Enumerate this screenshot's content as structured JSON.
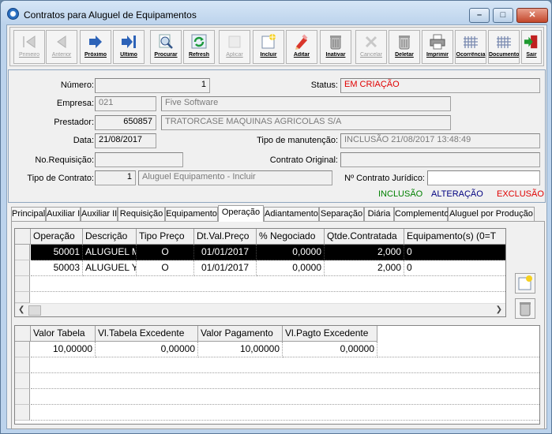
{
  "window": {
    "title": "Contratos para Aluguel de Equipamentos",
    "controls": [
      "minimize",
      "maximize",
      "close"
    ]
  },
  "toolbar": {
    "buttons": [
      {
        "label": "Primeiro",
        "icon": "first-icon",
        "enabled": false
      },
      {
        "label": "Anterior",
        "icon": "previous-icon",
        "enabled": false
      },
      {
        "label": "Próximo",
        "icon": "next-icon",
        "enabled": true
      },
      {
        "label": "Último",
        "icon": "last-icon",
        "enabled": true
      },
      {
        "label": "Procurar",
        "icon": "search-icon",
        "enabled": true
      },
      {
        "label": "Refresh",
        "icon": "refresh-icon",
        "enabled": true
      },
      {
        "label": "Aplicar",
        "icon": "apply-icon",
        "enabled": false
      },
      {
        "label": "Incluir",
        "icon": "new-icon",
        "enabled": true
      },
      {
        "label": "Aditar",
        "icon": "edit-icon",
        "enabled": true
      },
      {
        "label": "Inativar",
        "icon": "deactivate-icon",
        "enabled": true
      },
      {
        "label": "Cancelar",
        "icon": "cancel-icon",
        "enabled": false
      },
      {
        "label": "Deletar",
        "icon": "delete-icon",
        "enabled": true
      },
      {
        "label": "Imprimir",
        "icon": "print-icon",
        "enabled": true
      },
      {
        "label": "Ocorrência",
        "icon": "occurrence-icon",
        "enabled": true
      },
      {
        "label": "Documento",
        "icon": "document-icon",
        "enabled": true
      },
      {
        "label": "Sair",
        "icon": "exit-icon",
        "enabled": true
      }
    ]
  },
  "form": {
    "numero_label": "Número:",
    "numero": "1",
    "status_label": "Status:",
    "status": "EM CRIAÇÃO",
    "empresa_label": "Empresa:",
    "empresa_code": "021",
    "empresa_name": "Five Software",
    "prestador_label": "Prestador:",
    "prestador_code": "650857",
    "prestador_name": "TRATORCASE MAQUINAS AGRICOLAS S/A",
    "data_label": "Data:",
    "data": "21/08/2017",
    "tipo_manutencao_label": "Tipo de manutenção:",
    "tipo_manutencao": "INCLUSÃO 21/08/2017 13:48:49",
    "no_requisicao_label": "No.Requisição:",
    "no_requisicao": "",
    "contrato_original_label": "Contrato Original:",
    "contrato_original": "",
    "tipo_contrato_label": "Tipo de Contrato:",
    "tipo_contrato_code": "1",
    "tipo_contrato_name": "Aluguel Equipamento - Incluir",
    "contrato_juridico_label": "Nº Contrato Jurídico:",
    "contrato_juridico": ""
  },
  "legend": {
    "inclusao": "INCLUSÃO",
    "alteracao": "ALTERAÇÃO",
    "exclusao": "EXCLUSÃO",
    "colors": {
      "inclusao": "#008000",
      "alteracao": "#000080",
      "exclusao": "#e00000"
    }
  },
  "tabs": [
    "Principal",
    "Auxiliar I",
    "Auxiliar II",
    "Requisição",
    "Equipamento",
    "Operação",
    "Adiantamento",
    "Separação",
    "Diária",
    "Complemento",
    "Aluguel por Produção"
  ],
  "active_tab": "Operação",
  "operations_grid": {
    "columns": [
      "Operação",
      "Descrição",
      "Tipo Preço",
      "Dt.Val.Preço",
      "% Negociado",
      "Qtde.Contratada",
      "Equipamento(s) (0=T"
    ],
    "rows": [
      [
        "50001",
        "ALUGUEL M",
        "O",
        "01/01/2017",
        "0,0000",
        "2,000",
        "0"
      ],
      [
        "50003",
        "ALUGUEL Y",
        "O",
        "01/01/2017",
        "0,0000",
        "2,000",
        "0"
      ]
    ]
  },
  "values_grid": {
    "columns": [
      "Valor Tabela",
      "Vl.Tabela Excedente",
      "Valor Pagamento",
      "Vl.Pagto Excedente"
    ],
    "rows": [
      [
        "10,00000",
        "0,00000",
        "10,00000",
        "0,00000"
      ]
    ]
  }
}
